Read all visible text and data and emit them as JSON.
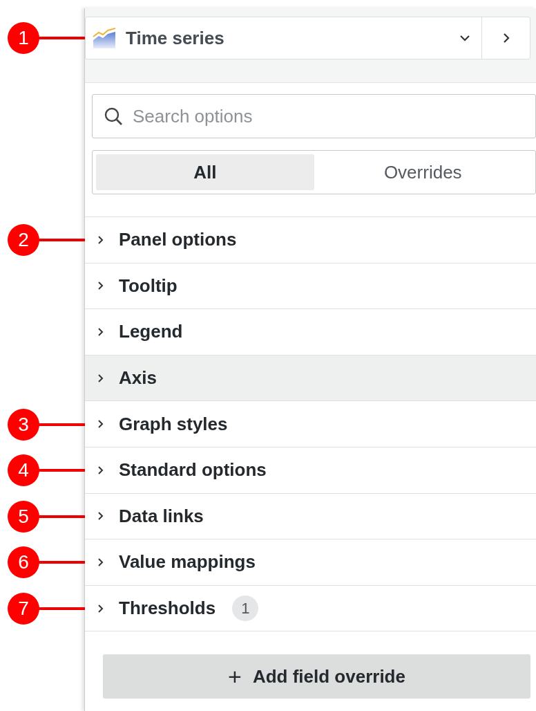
{
  "visualization": {
    "name": "Time series",
    "callout": "1"
  },
  "search": {
    "placeholder": "Search options"
  },
  "tabs": [
    {
      "label": "All",
      "selected": true
    },
    {
      "label": "Overrides",
      "selected": false
    }
  ],
  "sections": [
    {
      "label": "Panel options",
      "expanded": false,
      "highlighted": false,
      "callout": "2"
    },
    {
      "label": "Tooltip",
      "expanded": false,
      "highlighted": false
    },
    {
      "label": "Legend",
      "expanded": false,
      "highlighted": false
    },
    {
      "label": "Axis",
      "expanded": false,
      "highlighted": true
    },
    {
      "label": "Graph styles",
      "expanded": false,
      "highlighted": false,
      "callout": "3"
    },
    {
      "label": "Standard options",
      "expanded": false,
      "highlighted": false,
      "callout": "4"
    },
    {
      "label": "Data links",
      "expanded": false,
      "highlighted": false,
      "callout": "5"
    },
    {
      "label": "Value mappings",
      "expanded": false,
      "highlighted": false,
      "callout": "6"
    },
    {
      "label": "Thresholds",
      "expanded": false,
      "highlighted": false,
      "count": "1",
      "callout": "7"
    }
  ],
  "add_button": {
    "icon": "+",
    "label": "Add field override"
  }
}
